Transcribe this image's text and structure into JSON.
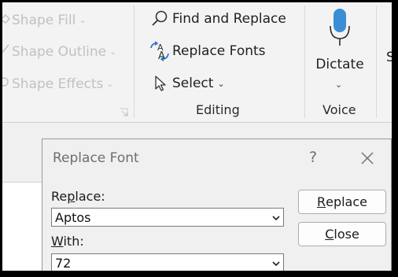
{
  "ribbon": {
    "drawing": {
      "shape_fill": "Shape Fill",
      "shape_outline": "Shape Outline",
      "shape_effects": "Shape Effects"
    },
    "editing": {
      "find_replace": "Find and Replace",
      "replace_fonts": "Replace Fonts",
      "select": "Select",
      "group_label": "Editing"
    },
    "voice": {
      "dictate": "Dictate",
      "group_label": "Voice"
    },
    "next_group_peek": "S"
  },
  "dialog": {
    "title": "Replace Font",
    "help": "?",
    "replace_label": {
      "before": "Re",
      "accel": "p",
      "after": "lace:"
    },
    "replace_value": "Aptos",
    "with_label": {
      "before": "",
      "accel": "W",
      "after": "ith:"
    },
    "with_value": "72",
    "replace_button": {
      "accel": "R",
      "rest": "eplace"
    },
    "close_button": {
      "accel": "C",
      "rest": "lose"
    }
  },
  "colors": {
    "ribbon_bg": "#f3f3f3",
    "disabled_text": "#c1c1c1",
    "mic_blue": "#3b8dd6",
    "dialog_bg": "#f0f0f0"
  }
}
